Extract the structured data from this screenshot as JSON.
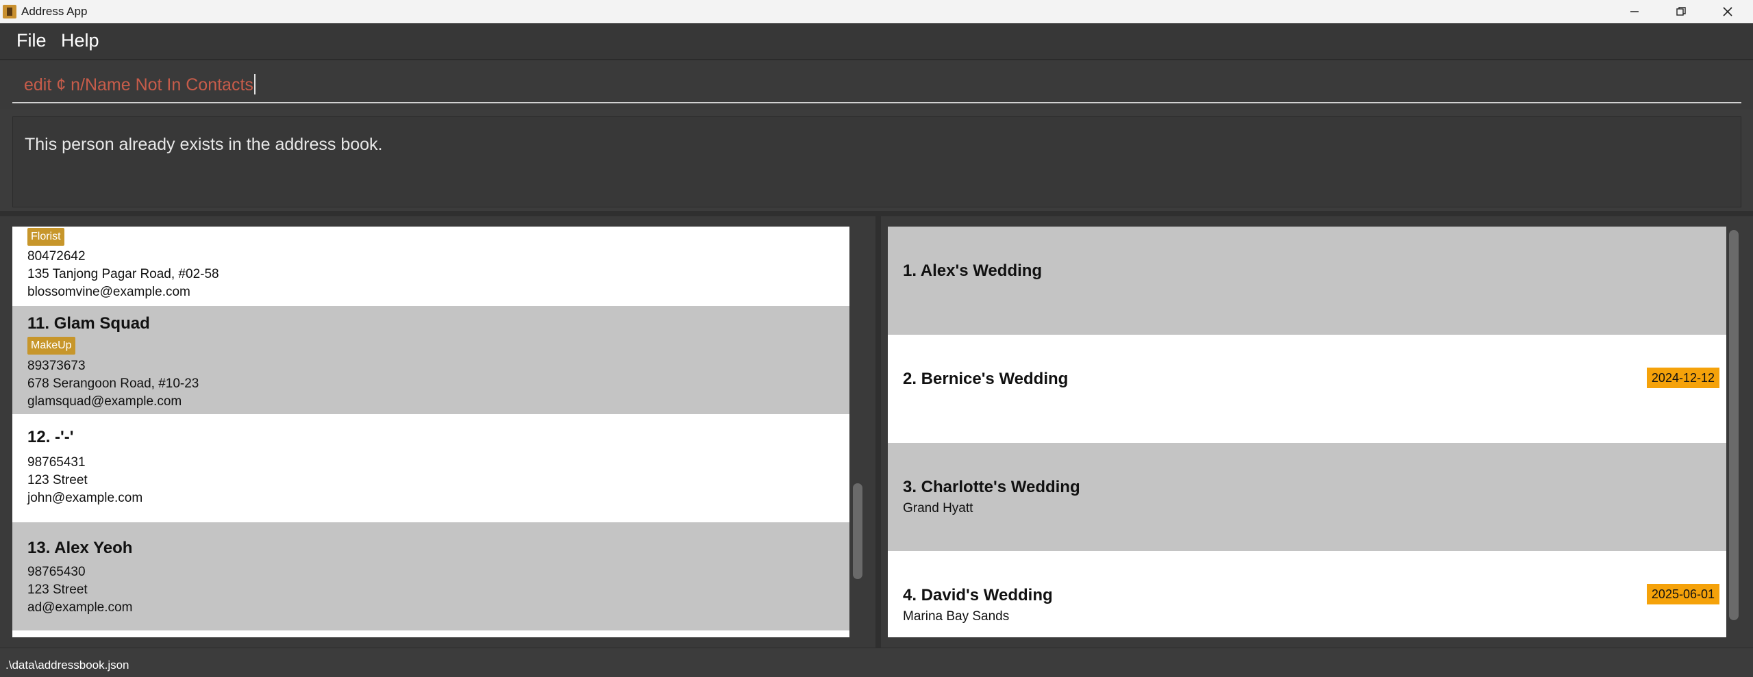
{
  "window": {
    "title": "Address App"
  },
  "menu": {
    "file": "File",
    "help": "Help"
  },
  "command": {
    "value": "edit ¢ n/Name Not In Contacts"
  },
  "result": {
    "message": "This person already exists in the address book."
  },
  "persons": [
    {
      "tag": "Florist",
      "phone": "80472642",
      "address": "135 Tanjong Pagar Road, #02-58",
      "email": "blossomvine@example.com"
    },
    {
      "name": "11. Glam Squad",
      "tag": "MakeUp",
      "phone": "89373673",
      "address": "678 Serangoon Road, #10-23",
      "email": "glamsquad@example.com"
    },
    {
      "name": "12. -'-'",
      "phone": "98765431",
      "address": "123 Street",
      "email": "john@example.com"
    },
    {
      "name": "13. Alex Yeoh",
      "phone": "98765430",
      "address": "123 Street",
      "email": "ad@example.com"
    }
  ],
  "weddings": [
    {
      "name": "1. Alex's Wedding"
    },
    {
      "name": "2. Bernice's Wedding",
      "date": "2024-12-12"
    },
    {
      "name": "3. Charlotte's Wedding",
      "venue": "Grand Hyatt"
    },
    {
      "name": "4. David's Wedding",
      "date": "2025-06-01",
      "venue": "Marina Bay Sands"
    }
  ],
  "status": {
    "path": ".\\data\\addressbook.json"
  },
  "colors": {
    "tag": "#c7962b",
    "date_badge": "#f5a20a",
    "command_text": "#c75c4a",
    "card_alt": "#c4c4c4"
  }
}
